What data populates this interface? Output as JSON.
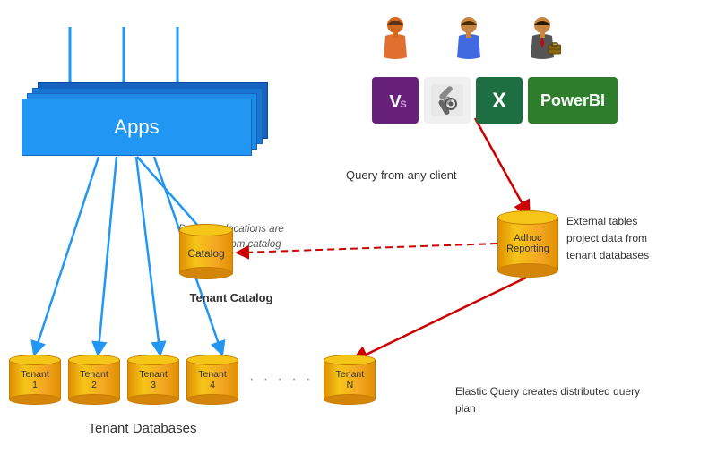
{
  "apps": {
    "label": "Apps"
  },
  "client_section": {
    "query_label": "Query from any client",
    "db_locations_label": "Database locations are\nretrieved from catalog",
    "tenant_catalog_label": "Tenant Catalog",
    "external_tables_label": "External tables\nproject data from\ntenant databases",
    "elastic_query_label": "Elastic Query creates\ndistributed query plan",
    "tenant_databases_label": "Tenant Databases"
  },
  "tools": {
    "vs_label": "VS",
    "settings_symbol": "⚙",
    "excel_symbol": "X",
    "powerbi_label": "PowerBI"
  },
  "cylinders": {
    "catalog_label": "Catalog",
    "adhoc_label": "Adhoc\nReporting",
    "tenant_labels": [
      "Tenant\n1",
      "Tenant\n2",
      "Tenant\n3",
      "Tenant\n4",
      "Tenant\nN"
    ]
  },
  "colors": {
    "blue": "#2196F3",
    "dark_blue": "#1565C0",
    "gold": "#F5A623",
    "dark_gold": "#C67C00",
    "red": "#CC0000",
    "green_powerbi": "#2D7D2D",
    "vs_purple": "#68217A",
    "excel_green": "#1D6F42"
  }
}
